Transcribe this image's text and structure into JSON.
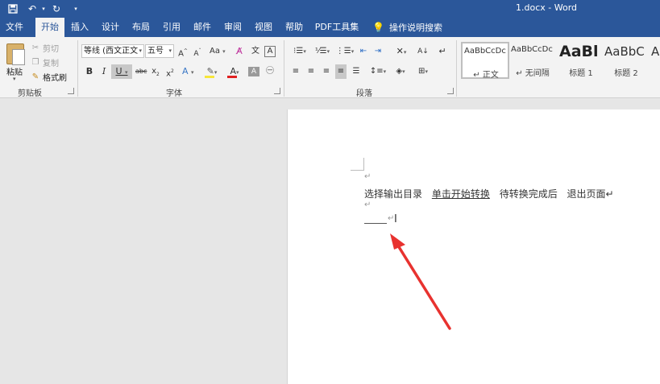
{
  "titlebar": {
    "doc_title": "1.docx  -  Word"
  },
  "tabs": [
    {
      "label": "文件"
    },
    {
      "label": "开始"
    },
    {
      "label": "插入"
    },
    {
      "label": "设计"
    },
    {
      "label": "布局"
    },
    {
      "label": "引用"
    },
    {
      "label": "邮件"
    },
    {
      "label": "审阅"
    },
    {
      "label": "视图"
    },
    {
      "label": "帮助"
    },
    {
      "label": "PDF工具集"
    }
  ],
  "active_tab": "开始",
  "tell_me": "操作说明搜索",
  "clipboard": {
    "paste": "粘贴",
    "cut": "剪切",
    "copy": "复制",
    "format_painter": "格式刷",
    "group_label": "剪贴板"
  },
  "font": {
    "font_name": "等线 (西文正文",
    "font_size": "五号",
    "group_label": "字体"
  },
  "paragraph": {
    "group_label": "段落"
  },
  "styles": [
    {
      "sample": "AaBbCcDc",
      "name": "↵ 正文"
    },
    {
      "sample": "AaBbCcDc",
      "name": "↵ 无间隔"
    },
    {
      "sample": "AaBl",
      "name": "标题 1"
    },
    {
      "sample": "AaBbC",
      "name": "标题 2"
    },
    {
      "sample": "A",
      "name": ""
    }
  ],
  "document": {
    "para_mark": "↵",
    "segments": [
      "选择输出目录",
      "单击开始转换",
      "待转换完成后",
      "退出页面↵"
    ],
    "cursor_mark": "↵"
  },
  "colors": {
    "brand": "#2b579a",
    "arrow": "#e8322f",
    "font_color_bar": "#e02020",
    "highlight_bar": "#f7e63a"
  }
}
